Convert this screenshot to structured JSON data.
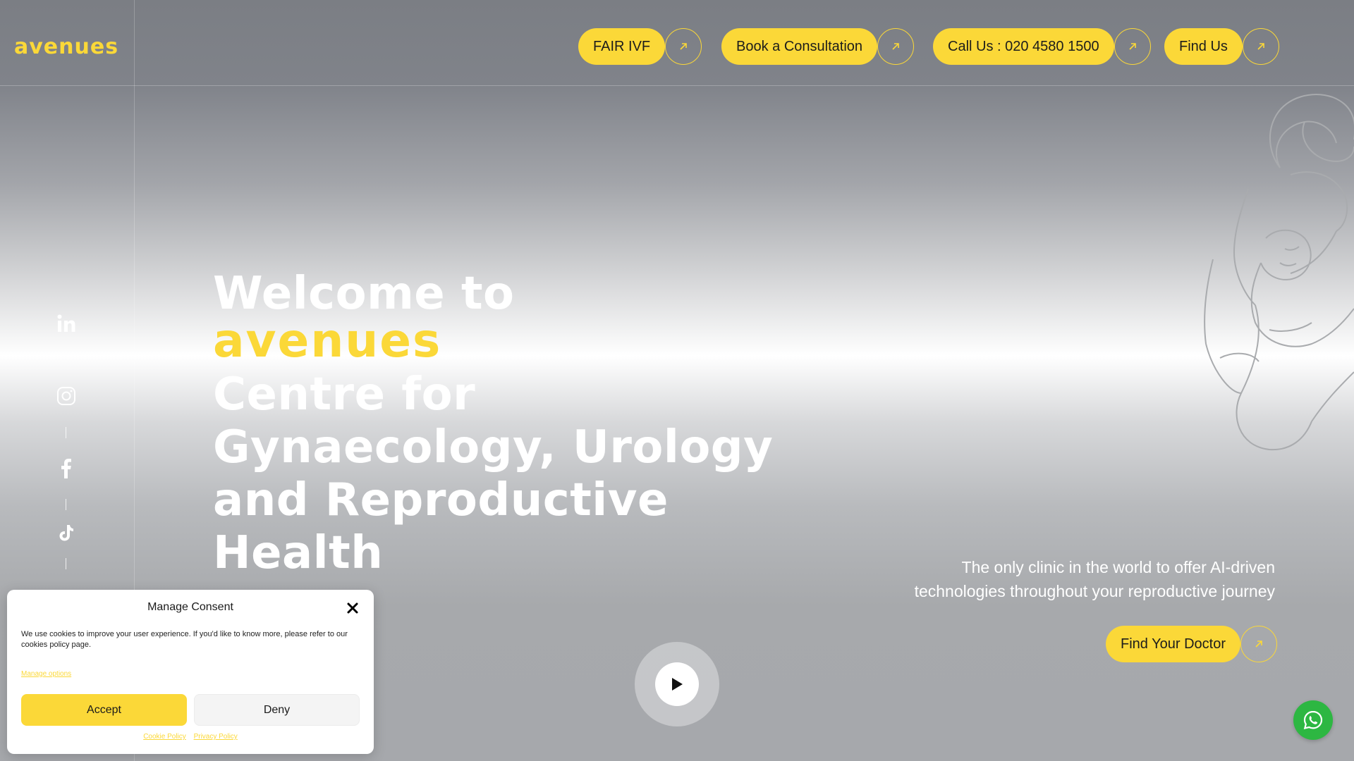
{
  "brand": {
    "name": "avenues",
    "accent": "#fbd838"
  },
  "nav": {
    "items": [
      {
        "label": "FAIR IVF"
      },
      {
        "label": "Book a Consultation"
      },
      {
        "label": "Call Us : 020 4580 1500"
      },
      {
        "label": "Find Us"
      }
    ]
  },
  "social": [
    "linkedin-icon",
    "instagram-icon",
    "facebook-icon",
    "tiktok-icon"
  ],
  "hero": {
    "line1": "Welcome to",
    "logo_text": "avenues",
    "line2": "Centre for",
    "line3": "Gynaecology, Urology",
    "line4": "and Reproductive Health"
  },
  "tagline": {
    "line1": "The only clinic in the world to offer AI-driven",
    "line2": "technologies throughout your reproductive journey"
  },
  "cta": {
    "find_doctor": "Find Your Doctor"
  },
  "consent": {
    "title": "Manage Consent",
    "text": "We use cookies to improve your user experience. If you'd like to know more, please refer to our cookies policy page.",
    "manage": "Manage options",
    "accept": "Accept",
    "deny": "Deny",
    "cookie_policy": "Cookie Policy",
    "privacy_policy": "Privacy Policy"
  },
  "colors": {
    "whatsapp": "#2db742",
    "pill": "#fbd838"
  }
}
